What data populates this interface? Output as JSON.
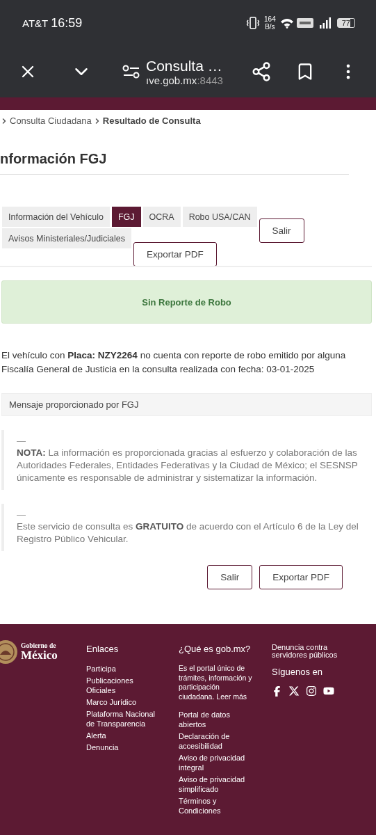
{
  "status_bar": {
    "carrier": "AT&T",
    "time": "16:59",
    "speed_value": "164",
    "speed_unit": "B/s",
    "battery": "77"
  },
  "browser": {
    "title": "Consulta …",
    "url_host": "ıve.gob.mx",
    "url_port": ":8443"
  },
  "breadcrumb": [
    "Consulta Ciudadana",
    "Resultado de Consulta"
  ],
  "heading": "nformación FGJ",
  "tabs": [
    {
      "label": "Información del Vehículo",
      "selected": false
    },
    {
      "label": "FGJ",
      "selected": true
    },
    {
      "label": "OCRA",
      "selected": false
    },
    {
      "label": "Robo USA/CAN",
      "selected": false
    },
    {
      "label": "Avisos Ministeriales/Judiciales",
      "selected": false
    }
  ],
  "top_buttons": {
    "exit": "Salir",
    "export": "Exportar PDF"
  },
  "alert": "Sin Reporte de Robo",
  "result_text": "El vehículo con **Placa: NZY2264** no cuenta con reporte de robo emitido por alguna Fiscalía General de Justicia en la consulta realizada con fecha: 03-01-2025",
  "message_header": "Mensaje proporcionado por FGJ",
  "notes": [
    {
      "dash": "—",
      "text": "**NOTA:** La información es proporcionada gracias al esfuerzo y colaboración de las Autoridades Federales, Entidades Federativas y la Ciudad de México; el SESNSP únicamente es responsable de administrar y sistematizar la información."
    },
    {
      "dash": "—",
      "text": "Este servicio de consulta es **GRATUITO** de acuerdo con el Artículo 6 de la Ley del Registro Público Vehicular."
    }
  ],
  "bottom_buttons": {
    "exit": "Salir",
    "export": "Exportar PDF"
  },
  "footer": {
    "logo_line1": "Gobierno de",
    "logo_line2": "México",
    "links_title": "Enlaces",
    "links": [
      "Participa",
      "Publicaciones Oficiales",
      "Marco Jurídico",
      "Plataforma Nacional de Transparencia",
      "Alerta",
      "Denuncia"
    ],
    "about_title": "¿Qué es gob.mx?",
    "about_text": "Es el portal único de trámites, información y participación ciudadana.",
    "about_link": "Leer más",
    "about_links": [
      "Portal de datos abiertos",
      "Declaración de accesibilidad",
      "Aviso de privacidad integral",
      "Aviso de privacidad simplificado",
      "Términos y Condiciones"
    ],
    "report_link": "Denuncia contra servidores públicos",
    "follow_title": "Síguenos en"
  }
}
